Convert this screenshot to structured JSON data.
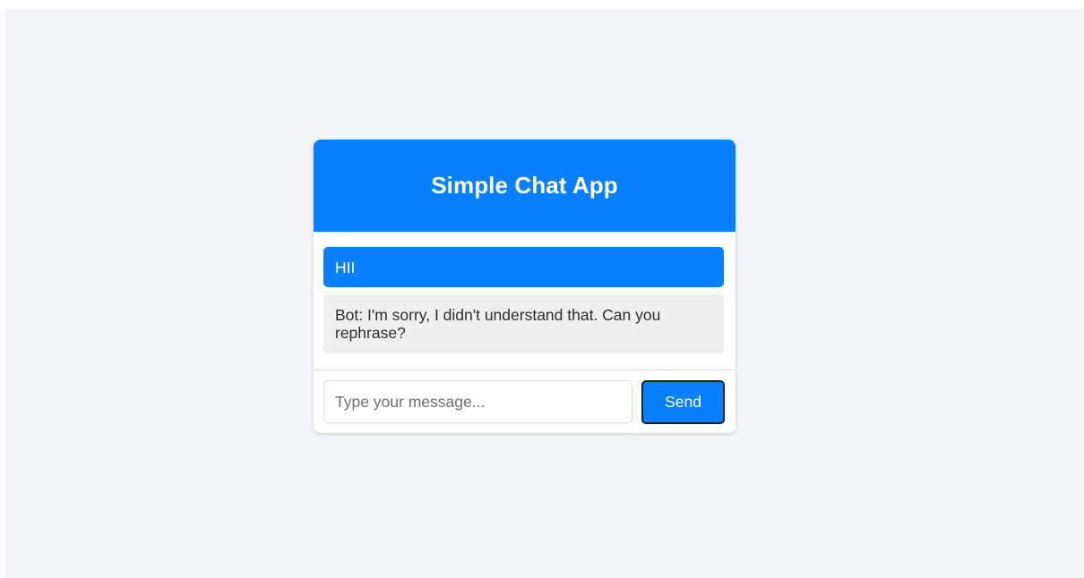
{
  "app": {
    "title": "Simple Chat App",
    "accent_color": "#0880fc",
    "page_background": "#f3f4f8"
  },
  "messages": [
    {
      "sender": "user",
      "text": "HII"
    },
    {
      "sender": "bot",
      "text": "Bot: I'm sorry, I didn't understand that. Can you rephrase?"
    }
  ],
  "composer": {
    "input_value": "",
    "placeholder": "Type your message...",
    "send_label": "Send"
  }
}
